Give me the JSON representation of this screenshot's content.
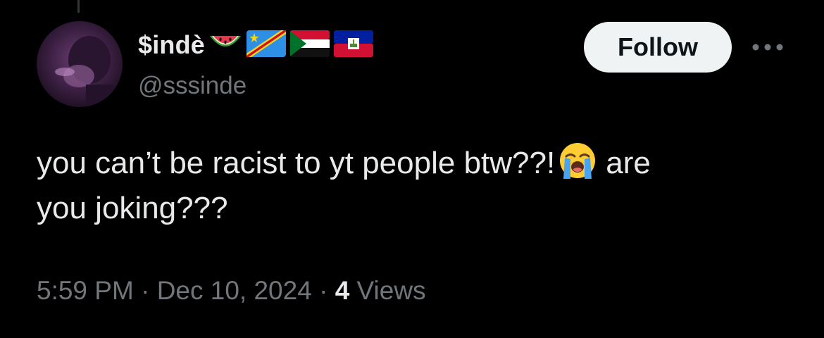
{
  "user": {
    "display_name": "$indè",
    "handle": "@sssinde"
  },
  "follow_label": "Follow",
  "tweet": {
    "line1": "you can’t be racist to yt people btw??!",
    "line1_tail": "are",
    "line2": "you joking???"
  },
  "meta": {
    "time": "5:59 PM",
    "separator": " · ",
    "date": "Dec 10, 2024",
    "views_count": "4",
    "views_label": " Views"
  },
  "icons": {
    "name_emojis": [
      "watermelon-icon",
      "dr-congo-flag-icon",
      "sudan-flag-icon",
      "haiti-flag-icon"
    ],
    "inline_emoji": "loudly-crying-face-icon",
    "more": "more-options-icon"
  },
  "colors": {
    "background": "#000000",
    "text_primary": "#e7e9ea",
    "text_secondary": "#71767b",
    "follow_bg": "#eff3f4"
  }
}
